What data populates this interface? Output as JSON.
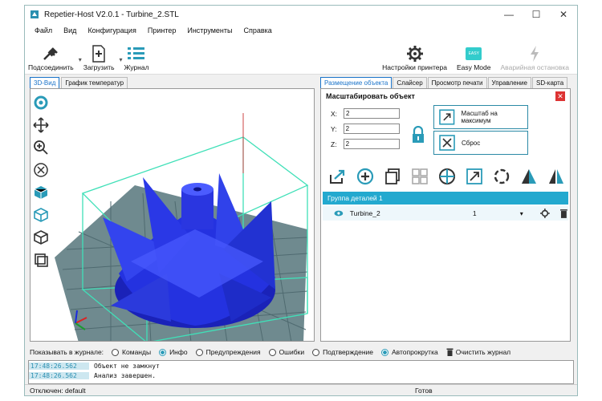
{
  "window": {
    "title": "Repetier-Host V2.0.1 - Turbine_2.STL"
  },
  "menu": [
    "Файл",
    "Вид",
    "Конфигурация",
    "Принтер",
    "Инструменты",
    "Справка"
  ],
  "toolbar": {
    "connect": "Подсоединить",
    "load": "Загрузить",
    "log": "Журнал",
    "printer_settings": "Настройки принтера",
    "easy_mode": "Easy Mode",
    "easy_badge": "EASY",
    "emergency": "Аварийная остановка"
  },
  "left_tabs": [
    "3D-Вид",
    "График температур"
  ],
  "right_tabs": [
    "Размещение объекта",
    "Слайсер",
    "Просмотр печати",
    "Управление",
    "SD-карта"
  ],
  "scale": {
    "title": "Масштабировать объект",
    "x_label": "X:",
    "x_value": "2",
    "y_label": "Y:",
    "y_value": "2",
    "z_label": "Z:",
    "z_value": "2",
    "max_scale": "Масштаб на максимум",
    "reset": "Сброс"
  },
  "objects": {
    "group_label": "Группа деталей 1",
    "part_name": "Turbine_2",
    "part_copies": "1"
  },
  "log": {
    "show_label": "Показывать в журнале:",
    "filters": [
      {
        "label": "Команды",
        "on": false
      },
      {
        "label": "Инфо",
        "on": true
      },
      {
        "label": "Предупреждения",
        "on": false
      },
      {
        "label": "Ошибки",
        "on": false
      },
      {
        "label": "Подтверждение",
        "on": false
      },
      {
        "label": "Автопрокрутка",
        "on": true
      }
    ],
    "clear": "Очистить журнал",
    "lines": [
      {
        "time": "17:48:26.562",
        "msg": "Объект не замкнут"
      },
      {
        "time": "17:48:26.562",
        "msg": "Анализ завершен."
      }
    ]
  },
  "status": {
    "left": "Отключен: default",
    "right": "Готов"
  },
  "colors": {
    "accent": "#23a9cf",
    "model": "#1f2bd8"
  }
}
